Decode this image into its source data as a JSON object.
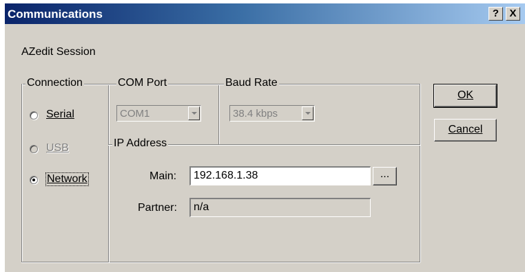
{
  "window": {
    "title": "Communications",
    "help_button": "?",
    "close_button": "X"
  },
  "session_label": "AZedit Session",
  "connection": {
    "group_title": "Connection",
    "options": [
      {
        "label": "Serial",
        "selected": false,
        "enabled": true
      },
      {
        "label": "USB",
        "selected": false,
        "enabled": false
      },
      {
        "label": "Network",
        "selected": true,
        "enabled": true
      }
    ]
  },
  "com_port": {
    "group_title": "COM Port",
    "value": "COM1"
  },
  "baud_rate": {
    "group_title": "Baud Rate",
    "value": "38.4 kbps"
  },
  "ip_address": {
    "group_title": "IP Address",
    "main_label": "Main:",
    "main_value": "192.168.1.38",
    "browse_label": "...",
    "partner_label": "Partner:",
    "partner_value": "n/a"
  },
  "buttons": {
    "ok": "OK",
    "cancel": "Cancel"
  },
  "colors": {
    "dialog_face": "#d4d0c8",
    "title_start": "#0a246a",
    "title_end": "#a6caf0"
  }
}
